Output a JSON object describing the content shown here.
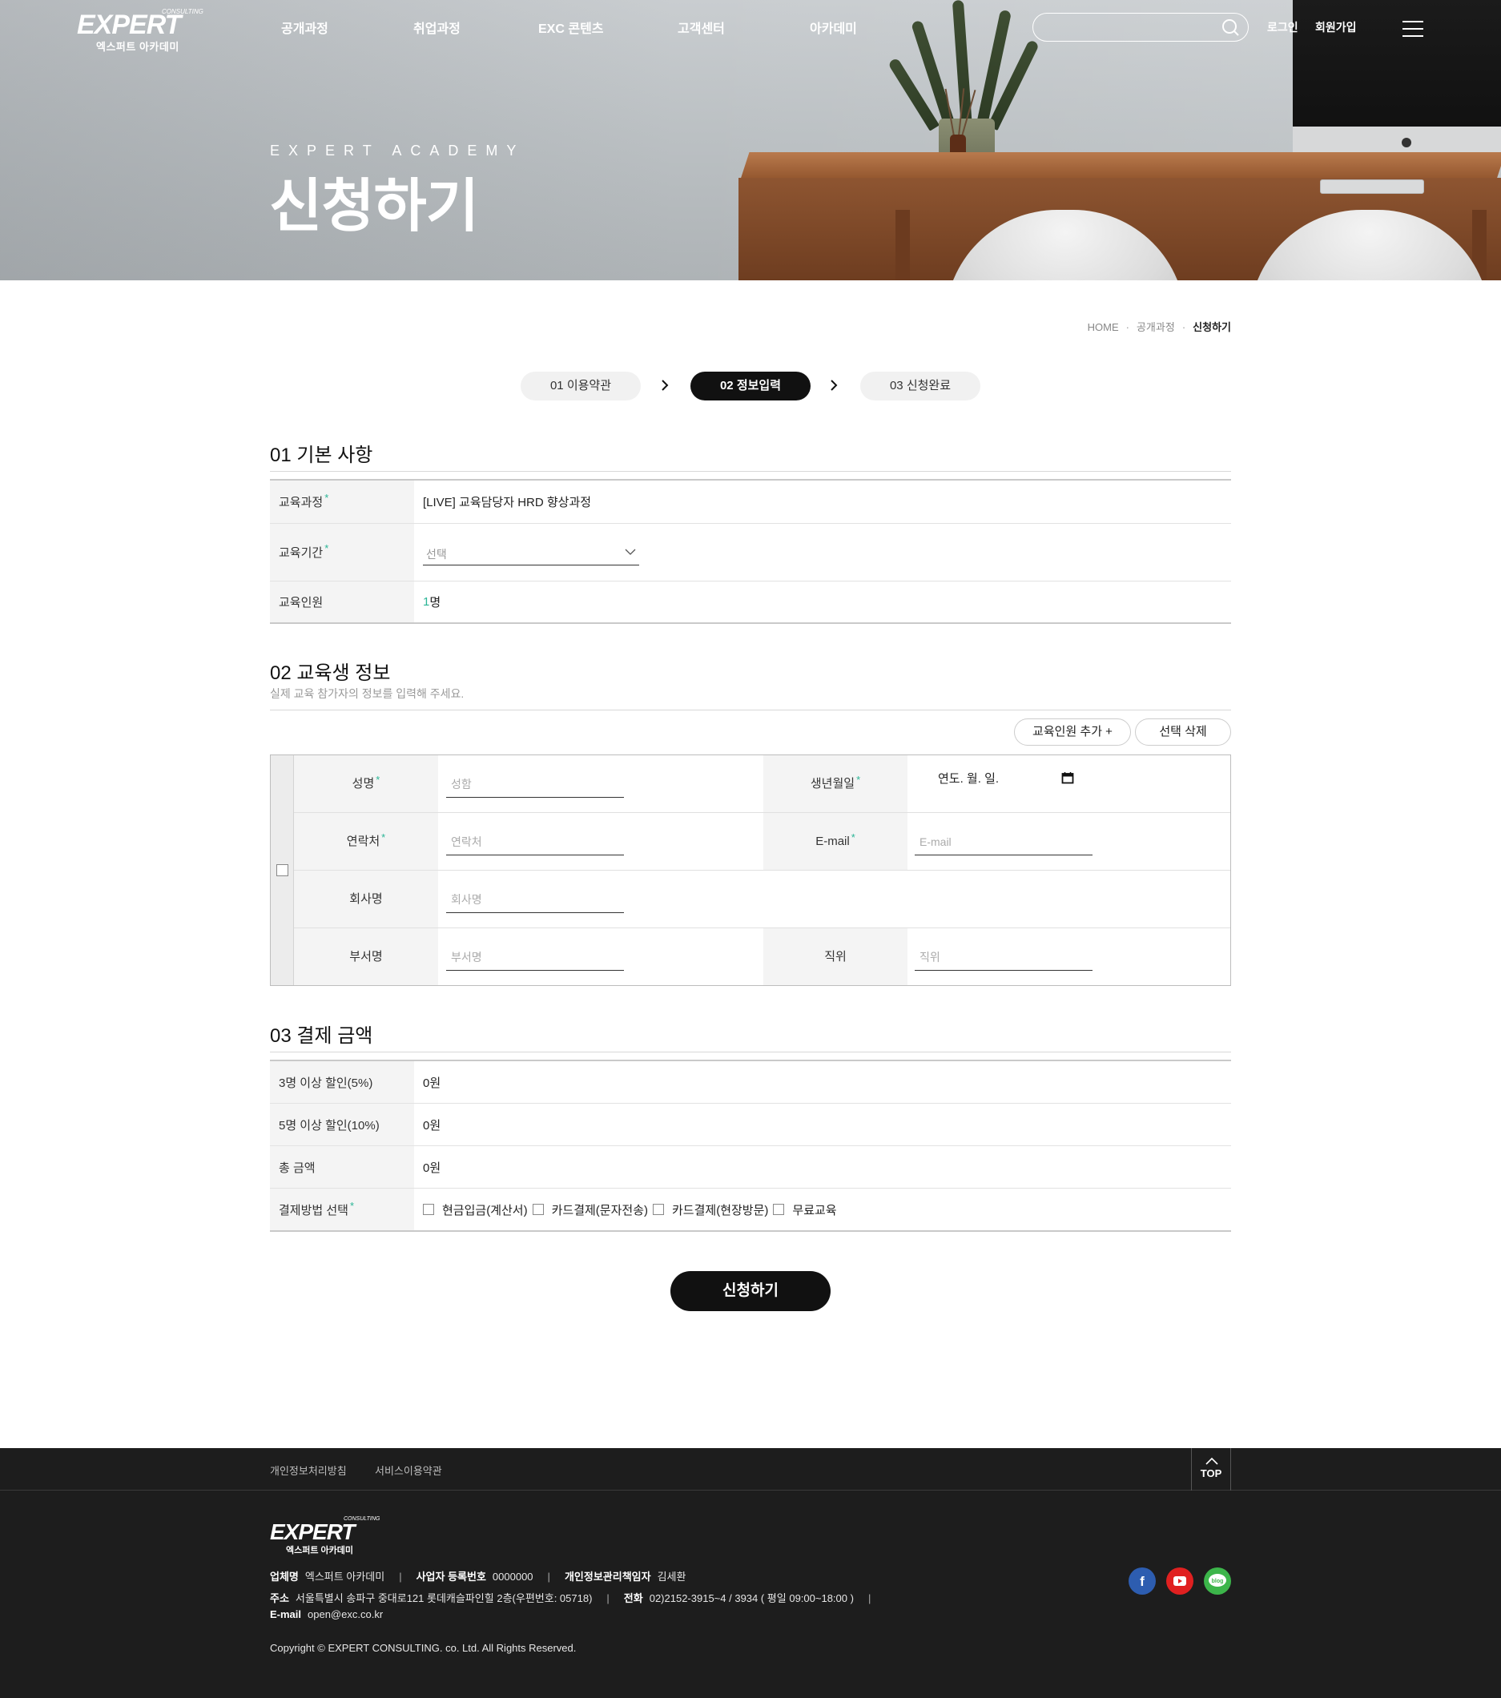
{
  "header": {
    "logo": {
      "word": "EXPERT",
      "small": "CONSULTING",
      "sub": "엑스퍼트 아카데미"
    },
    "nav": [
      "공개과정",
      "취업과정",
      "EXC 콘텐츠",
      "고객센터",
      "아카데미"
    ],
    "search_placeholder": "",
    "login": "로그인",
    "signup": "회원가입",
    "icons": {
      "search": "search-icon",
      "menu": "hamburger-menu-icon"
    }
  },
  "hero": {
    "eyebrow": "EXPERT ACADEMY",
    "title": "신청하기"
  },
  "breadcrumb": [
    "HOME",
    "공개과정",
    "신청하기"
  ],
  "steps": [
    {
      "label": "01 이용약관",
      "active": false
    },
    {
      "label": "02 정보입력",
      "active": true
    },
    {
      "label": "03 신청완료",
      "active": false
    }
  ],
  "section1": {
    "title": "01 기본 사항",
    "rows": {
      "course_label": "교육과정",
      "course_value": "[LIVE] 교육담당자 HRD 향상과정",
      "period_label": "교육기간",
      "period_value": "선택",
      "count_label": "교육인원",
      "count_num": "1",
      "count_unit": "명"
    }
  },
  "section2": {
    "title": "02 교육생 정보",
    "subtitle": "실제 교육 참가자의 정보를 입력해 주세요.",
    "add_button": "교육인원 추가 +",
    "delete_button": "선택 삭제",
    "fields": {
      "name_label": "성명",
      "name_placeholder": "성함",
      "birth_label": "생년월일",
      "birth_value": "연도. 월. 일.",
      "phone_label": "연락처",
      "phone_placeholder": "연락처",
      "email_label": "E-mail",
      "email_placeholder": "E-mail",
      "company_label": "회사명",
      "company_placeholder": "회사명",
      "dept_label": "부서명",
      "dept_placeholder": "부서명",
      "position_label": "직위",
      "position_placeholder": "직위"
    }
  },
  "section3": {
    "title": "03 결제 금액",
    "rows": [
      {
        "label": "3명 이상 할인(5%)",
        "value": "0원"
      },
      {
        "label": "5명 이상 할인(10%)",
        "value": "0원"
      },
      {
        "label": "총 금액",
        "value": "0원"
      }
    ],
    "payment_label": "결제방법 선택",
    "payment_options": [
      "현금입금(계산서)",
      "카드결제(문자전송)",
      "카드결제(현장방문)",
      "무료교육"
    ]
  },
  "submit_label": "신청하기",
  "footer": {
    "links": [
      "개인정보처리방침",
      "서비스이용약관"
    ],
    "top_label": "TOP",
    "logo": {
      "word": "EXPERT",
      "small": "CONSULTING",
      "sub": "엑스퍼트 아카데미"
    },
    "company_key": "업체명",
    "company_val": "엑스퍼트 아카데미",
    "biz_key": "사업자 등록번호",
    "biz_val": "0000000",
    "privacy_key": "개인정보관리책임자",
    "privacy_val": "김세환",
    "addr_key": "주소",
    "addr_val": "서울특별시 송파구 중대로121 롯데캐슬파인힐 2층(우편번호: 05718)",
    "tel_key": "전화",
    "tel_val": "02)2152-3915~4 / 3934 ( 평일 09:00~18:00 )",
    "email_key": "E-mail",
    "email_val": "open@exc.co.kr",
    "copyright": "Copyright © EXPERT CONSULTING. co. Ltd. All Rights Reserved.",
    "sns": [
      {
        "name": "facebook-icon",
        "color": "#2d5db0",
        "glyph": "f"
      },
      {
        "name": "youtube-icon",
        "color": "#e02020",
        "glyph": "▶"
      },
      {
        "name": "blog-icon",
        "color": "#3cb54a",
        "glyph": "blog"
      }
    ]
  },
  "colors": {
    "accent": "#2bb596",
    "dark": "#111111",
    "footer_bg": "#1d1d1d"
  }
}
